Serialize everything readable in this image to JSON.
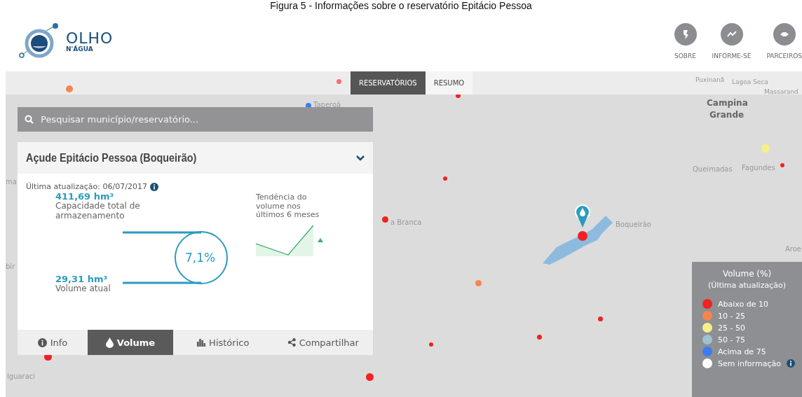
{
  "caption": "Figura 5 - Informações sobre o reservatório Epitácio Pessoa",
  "logo": {
    "top": "OLHO",
    "bottom": "N'ÁGUA"
  },
  "nav": [
    {
      "label": "SOBRE"
    },
    {
      "label": "INFORME-SE"
    },
    {
      "label": "PARCEIROS"
    }
  ],
  "map_tabs": [
    {
      "label": "RESERVATÓRIOS",
      "selected": true
    },
    {
      "label": "RESUMO",
      "selected": false
    }
  ],
  "map_labels": [
    "Puxinanã",
    "Lagoa Seca",
    "Massarand",
    "Campina",
    "Taperoá",
    "Grande",
    "Fagundes",
    "Queimadas",
    "ma",
    "a Branca",
    "Boqueirão",
    "Aroe",
    "bir",
    "lguaraci"
  ],
  "search": {
    "placeholder": "Pesquisar município/reservatório..."
  },
  "card": {
    "title": "Açude Epitácio Pessoa (Boqueirão)",
    "expanded": true,
    "updated": "Última atualização: 06/07/2017",
    "capacity_value": "411,69 hm³",
    "capacity_label": "Capacidade total de armazenamento",
    "current_value": "29,31 hm³",
    "current_label": "Volume atual",
    "percent": "7,1%",
    "trend_label": "Tendência do volume nos últimos 6 meses",
    "tabs": [
      {
        "label": "Info",
        "kind": "info",
        "selected": false
      },
      {
        "label": "Volume",
        "kind": "drop",
        "selected": true
      },
      {
        "label": "Histórico",
        "kind": "bars",
        "selected": false
      },
      {
        "label": "Compartilhar",
        "kind": "share",
        "selected": false
      }
    ]
  },
  "legend": {
    "title": "Volume (%)",
    "subtitle": "(Última atualização)",
    "items": [
      {
        "label": "Abaixo de 10",
        "color": "#f02222"
      },
      {
        "label": "10 - 25",
        "color": "#f5864f"
      },
      {
        "label": "25 - 50",
        "color": "#f7f08a"
      },
      {
        "label": "50 - 75",
        "color": "#9cc3d3"
      },
      {
        "label": "Acima de 75",
        "color": "#3b7cf0"
      },
      {
        "label": "Sem informação",
        "color": "#ffffff"
      }
    ]
  }
}
